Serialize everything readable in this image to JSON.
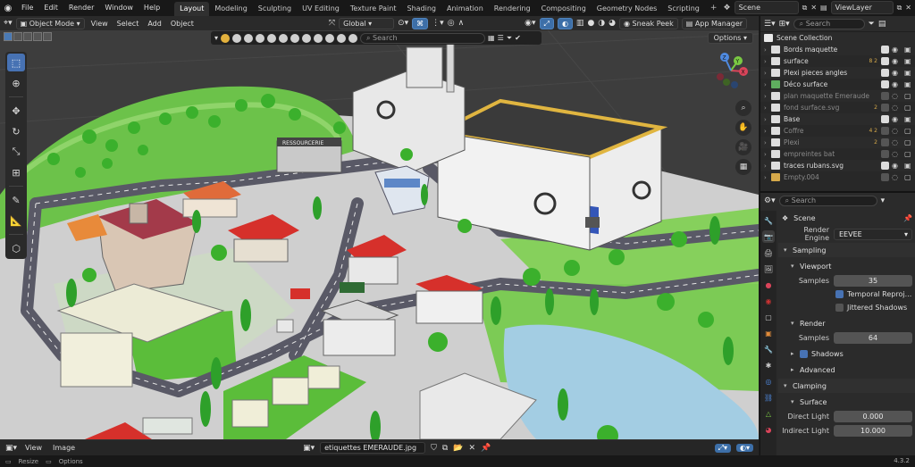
{
  "menus": [
    "File",
    "Edit",
    "Render",
    "Window",
    "Help"
  ],
  "workspaces": [
    "Layout",
    "Modeling",
    "Sculpting",
    "UV Editing",
    "Texture Paint",
    "Shading",
    "Animation",
    "Rendering",
    "Compositing",
    "Geometry Nodes",
    "Scripting"
  ],
  "active_workspace": "Layout",
  "scene_name": "Scene",
  "view_layer": "ViewLayer",
  "viewport": {
    "mode": "Object Mode",
    "menu": [
      "View",
      "Select",
      "Add",
      "Object"
    ],
    "orientation": "Global",
    "sneak_peek": "Sneak Peek",
    "app_manager": "App Manager",
    "search_placeholder": "Search",
    "options": "Options",
    "gizmo": {
      "x": "X",
      "y": "Y",
      "z": "Z"
    }
  },
  "image_editor": {
    "menu": [
      "View",
      "Image"
    ],
    "image_name": "etiquettes EMERAUDE.jpg"
  },
  "statusbar": {
    "resize": "Resize",
    "options": "Options",
    "version": "4.3.2"
  },
  "outliner": {
    "search_placeholder": "Search",
    "root": "Scene Collection",
    "items": [
      {
        "name": "Bords maquette",
        "badge": "",
        "color": "#dddddd",
        "enabled": true,
        "dim": false
      },
      {
        "name": "surface",
        "badge": "8 2",
        "color": "#dddddd",
        "enabled": true,
        "dim": false
      },
      {
        "name": "Plexi pieces angles",
        "badge": "",
        "color": "#dddddd",
        "enabled": true,
        "dim": false
      },
      {
        "name": "Déco surface",
        "badge": "",
        "color": "#5fae5f",
        "enabled": true,
        "dim": false
      },
      {
        "name": "plan maquette Emeraude",
        "badge": "",
        "color": "#dddddd",
        "enabled": false,
        "dim": true
      },
      {
        "name": "fond surface.svg",
        "badge": "2",
        "color": "#dddddd",
        "enabled": false,
        "dim": true
      },
      {
        "name": "Base",
        "badge": "",
        "color": "#dddddd",
        "enabled": true,
        "dim": false
      },
      {
        "name": "Coffre",
        "badge": "4 2",
        "color": "#dddddd",
        "enabled": false,
        "dim": true
      },
      {
        "name": "Plexi",
        "badge": "2",
        "color": "#dddddd",
        "enabled": false,
        "dim": true
      },
      {
        "name": "empreintes bat",
        "badge": "",
        "color": "#dddddd",
        "enabled": false,
        "dim": true
      },
      {
        "name": "traces rubans.svg",
        "badge": "",
        "color": "#dddddd",
        "enabled": true,
        "dim": false
      },
      {
        "name": "Empty.004",
        "badge": "",
        "color": "#d6a94a",
        "enabled": false,
        "dim": true
      }
    ]
  },
  "properties": {
    "search_placeholder": "Search",
    "scene": "Scene",
    "render_engine_label": "Render Engine",
    "render_engine": "EEVEE",
    "sampling": "Sampling",
    "viewport": "Viewport",
    "samples_label": "Samples",
    "viewport_samples": "35",
    "temporal_reprojection": "Temporal Reproj...",
    "jittered_shadows": "Jittered Shadows",
    "render": "Render",
    "render_samples": "64",
    "shadows": "Shadows",
    "advanced": "Advanced",
    "clamping": "Clamping",
    "surface": "Surface",
    "direct_light_label": "Direct Light",
    "direct_light": "0.000",
    "indirect_light_label": "Indirect Light",
    "indirect_light": "10.000"
  },
  "colors": {
    "accent": "#4772b3",
    "grass": "#6fc54a",
    "road": "#5c5c66",
    "water": "#9ec8e0",
    "roof_red": "#d6302b",
    "factory_yellow": "#e0b540"
  }
}
